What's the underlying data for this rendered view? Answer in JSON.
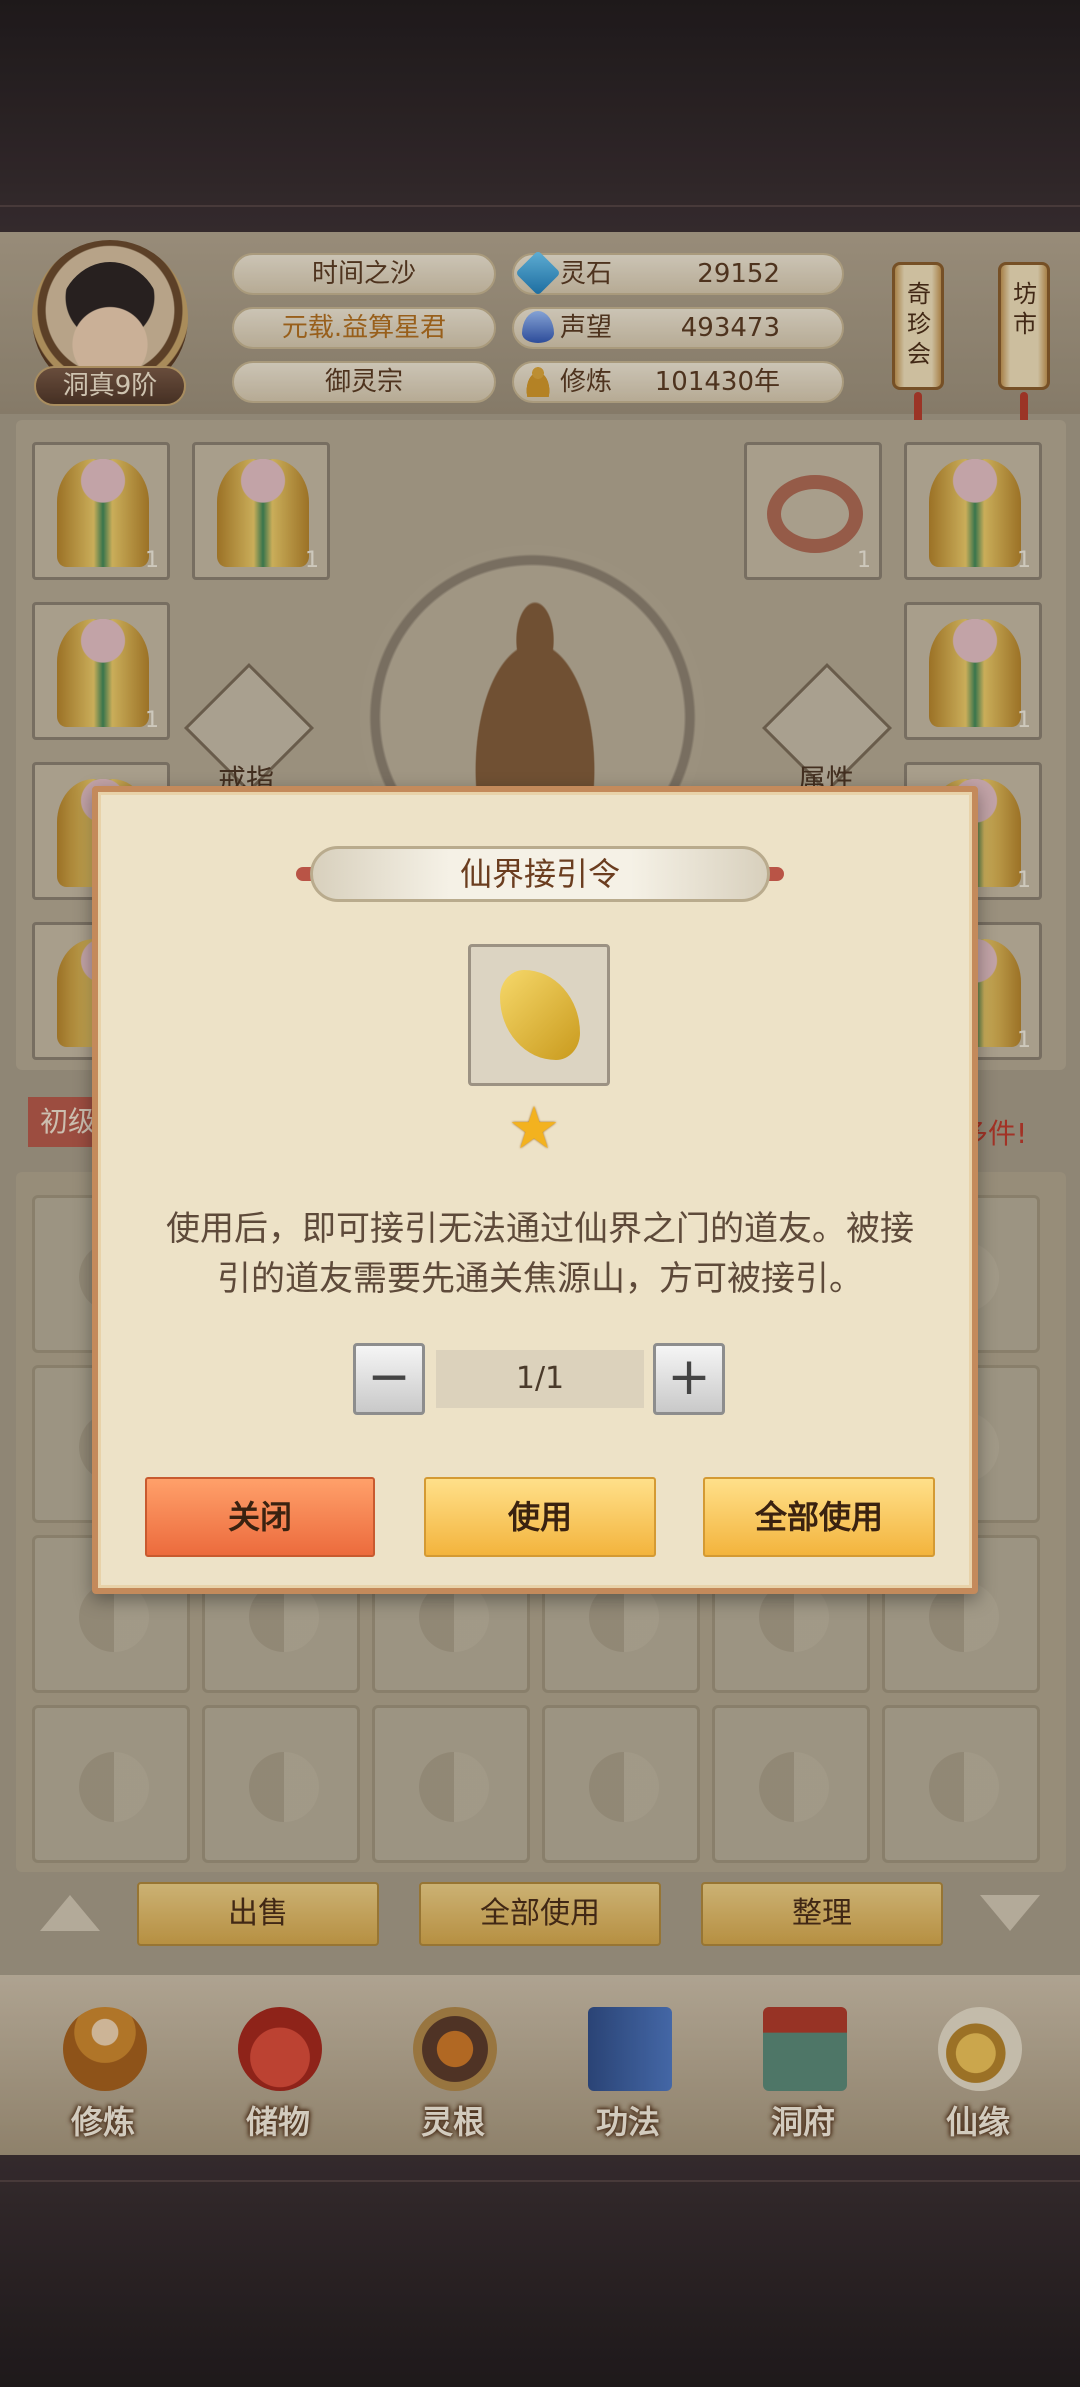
{
  "player": {
    "rank": "洞真9阶",
    "title": "时间之沙",
    "honor": "元载.益算星君",
    "sect": "御灵宗"
  },
  "resources": [
    {
      "label": "灵石",
      "value": "29152",
      "icon": "spirit-stone-icon",
      "color": "#2f9fd6"
    },
    {
      "label": "声望",
      "value": "493473",
      "icon": "reputation-crystal-icon",
      "color": "#3c73c8"
    },
    {
      "label": "修炼",
      "value": "101430年",
      "icon": "meditation-figure-icon",
      "color": "#d69a2a"
    }
  ],
  "side_tags": {
    "treasure": "奇珍会",
    "market": "坊市"
  },
  "equipment": {
    "ring_slot_label": "戒指",
    "attr_slot_label": "属性",
    "counts": [
      "1",
      "1",
      "1",
      "1",
      "1",
      "1",
      "1",
      "1",
      "1",
      "1",
      "1"
    ]
  },
  "banners": {
    "left": "初级",
    "right": "多件!"
  },
  "inventory_actions": {
    "sell": "出售",
    "use_all": "全部使用",
    "sort": "整理"
  },
  "nav": [
    {
      "label": "修炼",
      "icon": "cultivation-monk-icon"
    },
    {
      "label": "储物",
      "icon": "storage-bag-icon"
    },
    {
      "label": "灵根",
      "icon": "spirit-root-icon"
    },
    {
      "label": "功法",
      "icon": "technique-book-icon"
    },
    {
      "label": "洞府",
      "icon": "cave-dwelling-icon"
    },
    {
      "label": "仙缘",
      "icon": "immortal-fate-icon"
    }
  ],
  "dialog": {
    "title": "仙界接引令",
    "item_icon": "golden-scroll-icon",
    "stars": "★",
    "description": "使用后，即可接引无法通过仙界之门的道友。被接引的道友需要先通关焦源山，方可被接引。",
    "quantity": "1/1",
    "minus": "−",
    "plus": "+",
    "close_label": "关闭",
    "use_label": "使用",
    "use_all_label": "全部使用"
  }
}
